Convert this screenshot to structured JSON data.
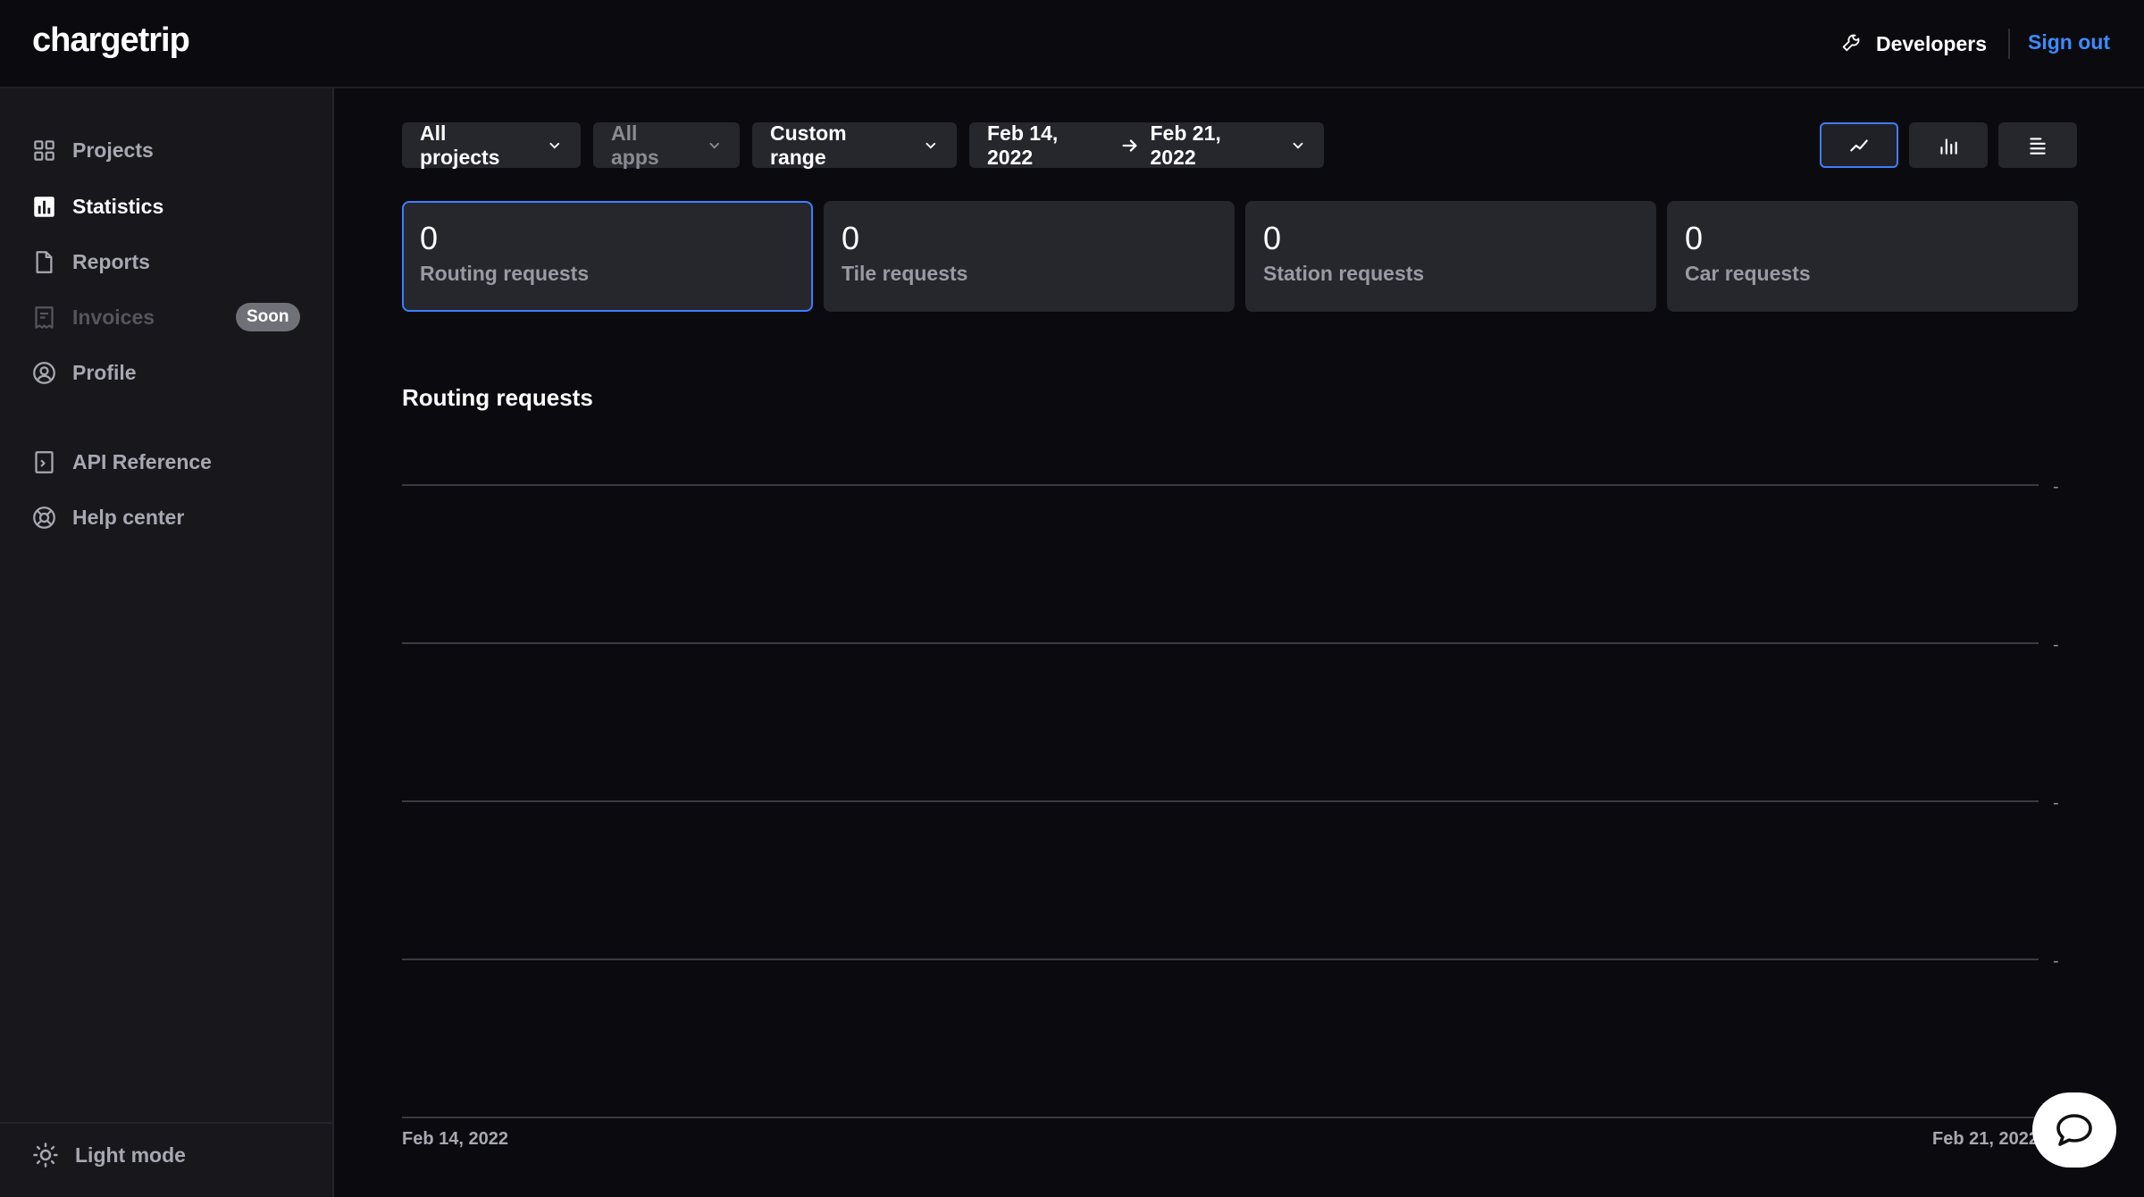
{
  "header": {
    "logo": "chargetrip",
    "developers_label": "Developers",
    "signout_label": "Sign out"
  },
  "sidebar": {
    "items": [
      {
        "label": "Projects",
        "icon": "grid-icon",
        "state": "normal"
      },
      {
        "label": "Statistics",
        "icon": "bar-chart-icon",
        "state": "active"
      },
      {
        "label": "Reports",
        "icon": "document-icon",
        "state": "normal"
      },
      {
        "label": "Invoices",
        "icon": "receipt-icon",
        "state": "disabled",
        "badge": "Soon"
      },
      {
        "label": "Profile",
        "icon": "user-circle-icon",
        "state": "normal"
      },
      {
        "label": "API Reference",
        "icon": "terminal-icon",
        "state": "normal"
      },
      {
        "label": "Help center",
        "icon": "lifebuoy-icon",
        "state": "normal"
      }
    ],
    "light_mode_label": "Light mode"
  },
  "filters": {
    "projects": "All projects",
    "apps": "All apps",
    "range": "Custom range",
    "date_from": "Feb 14, 2022",
    "date_to": "Feb 21, 2022"
  },
  "view_toggle": {
    "active": "line-chart",
    "options": [
      "line-chart-icon",
      "bar-chart-icon",
      "list-icon"
    ]
  },
  "stats": [
    {
      "value": "0",
      "label": "Routing requests"
    },
    {
      "value": "0",
      "label": "Tile requests"
    },
    {
      "value": "0",
      "label": "Station requests"
    },
    {
      "value": "0",
      "label": "Car requests"
    }
  ],
  "chart_data": {
    "type": "line",
    "title": "Routing requests",
    "x": [
      "Feb 14, 2022",
      "Feb 21, 2022"
    ],
    "y_tick_labels": [
      "-",
      "-",
      "-",
      "-"
    ],
    "series": [],
    "grid": true
  },
  "colors": {
    "accent": "#3d7eff",
    "signout": "#3d8bff",
    "background": "#0b0b0f",
    "sidebar": "#17171c",
    "card": "#26262d"
  }
}
